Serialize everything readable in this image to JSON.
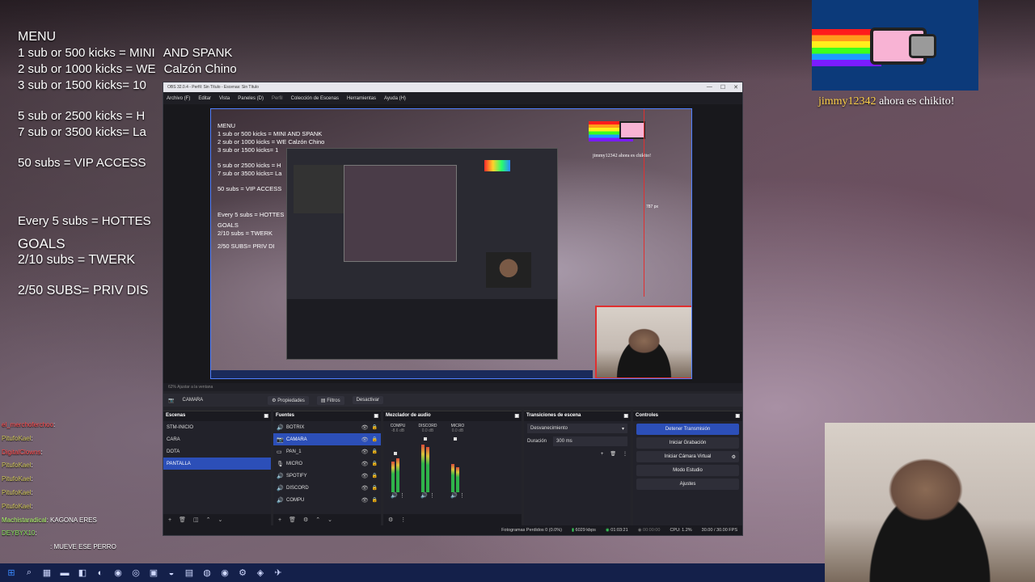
{
  "overlay_menu": {
    "title": "MENU",
    "lines": [
      "1 sub or 500 kicks = MINI",
      "AND SPANK",
      "2 sub or 1000 kicks = WE",
      "Calzón Chino",
      "3 sub or 1500 kicks= 10",
      "5 sub or 2500 kicks = H",
      "7 sub or 3500 kicks= La",
      "50 subs = VIP ACCESS",
      "Every 5 subs = HOTTES",
      "GOALS",
      "2/10 subs = TWERK",
      "2/50 SUBS= PRIV DIS"
    ]
  },
  "alert": {
    "user": "jimmy12342",
    "text": "ahora es chikito!"
  },
  "chat": [
    {
      "user": "el_merchoferchoo",
      "msg": ":"
    },
    {
      "user": "PitufoKael",
      "msg": ":"
    },
    {
      "user": "DigitalClowns",
      "msg": ":"
    },
    {
      "user": "PitufoKael",
      "msg": ":"
    },
    {
      "user": "PitufoKael",
      "msg": ":"
    },
    {
      "user": "PitufoKael",
      "msg": ":"
    },
    {
      "user": "PitufoKael",
      "msg": ":"
    },
    {
      "user": "Machistaradical",
      "msg": ": KAGONA ERES"
    },
    {
      "user": "DEYBYX10",
      "msg": ":"
    },
    {
      "user": "",
      "msg": ": MUEVE ESE PERRO"
    }
  ],
  "obs": {
    "title": "OBS 32.0.4 - Perfil: Sin Título - Escenas: Sin Título",
    "menu": [
      "Archivo (F)",
      "Editar",
      "Vista",
      "Paneles (D)",
      "Perfil",
      "Colección de Escenas",
      "Herramientas",
      "Ayuda (H)"
    ],
    "canvas_overlay": {
      "title": "MENU",
      "lines": [
        "1 sub or 500 kicks = MINI  AND SPANK",
        "2 sub or 1000 kicks = WE  Calzón Chino",
        "3 sub or 1500 kicks= 1",
        "5 sub or 2500 kicks = H",
        "7 sub or 3500 kicks= La",
        "50 subs = VIP ACCESS",
        "Every 5 subs = HOTTES",
        "GOALS",
        "2/10 subs = TWERK",
        "2/50 SUBS= PRIV DI"
      ]
    },
    "selection_px": "787 px",
    "zoom_label": "62%  Ajustar a la ventana",
    "source_bar": {
      "selected": "CAMARA",
      "properties": "Propiedades",
      "filters": "Filtros",
      "deactivate": "Desactivar"
    },
    "scenes": {
      "header": "Escenas",
      "items": [
        "STM-INICIO",
        "CARA",
        "DOTA",
        "PANTALLA"
      ],
      "selected": 3
    },
    "sources": {
      "header": "Fuentes",
      "items": [
        {
          "icon": "🔊",
          "name": "BOTRIX"
        },
        {
          "icon": "📷",
          "name": "CAMARA"
        },
        {
          "icon": "▭",
          "name": "PAN_1"
        },
        {
          "icon": "🎙",
          "name": "MICRO"
        },
        {
          "icon": "🔊",
          "name": "SPOTIFY"
        },
        {
          "icon": "🔊",
          "name": "DISCORD"
        },
        {
          "icon": "🔊",
          "name": "COMPU"
        }
      ],
      "selected": 1
    },
    "mixer": {
      "header": "Mezclador de audio",
      "channels": [
        {
          "name": "COMPU",
          "db": "-8.6 dB",
          "levels": [
            0.55,
            0.6
          ]
        },
        {
          "name": "DISCORD",
          "db": "0.0 dB",
          "levels": [
            0.85,
            0.8
          ]
        },
        {
          "name": "MICRO",
          "db": "0.0 dB",
          "levels": [
            0.5,
            0.45
          ]
        }
      ]
    },
    "transitions": {
      "header": "Transiciones de escena",
      "value": "Desvanecimiento",
      "duration_label": "Duración",
      "duration": "300 ms"
    },
    "controls": {
      "header": "Controles",
      "buttons": [
        "Detener Transmisión",
        "Iniciar Grabación",
        "Iniciar Cámara Virtual",
        "Modo Estudio",
        "Ajustes"
      ]
    },
    "status": {
      "dropped": "Fotogramas Perdidos 0 (0.0%)",
      "bitrate": "6029 kbps",
      "live_time": "01:03:21",
      "rec_time": "00:00:00",
      "cpu": "CPU: 1.2%",
      "fps": "30.00 / 30.00 FPS"
    }
  },
  "colors": {
    "accent": "#2c4fb8",
    "selection": "#e03030"
  }
}
